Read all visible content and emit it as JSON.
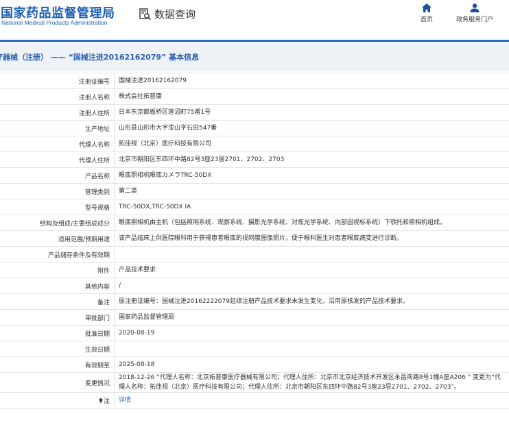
{
  "header": {
    "logo_cn": "国家药品监督管理局",
    "logo_en": "National Medical Products Administration",
    "query_label": "数据查询",
    "nav": [
      {
        "label": "首页",
        "icon": "home-icon"
      },
      {
        "label": "政务服务门户",
        "icon": "user-group-icon"
      }
    ],
    "accent_color": "#2a6cc0"
  },
  "breadcrumb": "疗器械（注册） —— “国械注进20162162079” 基本信息",
  "rows": [
    {
      "key": "注册证编号",
      "value": "国械注进20162162079"
    },
    {
      "key": "注册人名称",
      "value": "株式会社拓普康"
    },
    {
      "key": "注册人住所",
      "value": "日本东京都板桥区莲沼町75番1号"
    },
    {
      "key": "生产地址",
      "value": "山形县山形市大字漆山字石田547番"
    },
    {
      "key": "代理人名称",
      "value": "拓佳视（北京）医疗科技有限公司"
    },
    {
      "key": "代理人住所",
      "value": "北京市朝阳区东四环中路82号3座23层2701、2702、2703"
    },
    {
      "key": "产品名称",
      "value": "眼底照相机眼底カメラTRC-50DX"
    },
    {
      "key": "管理类别",
      "value": "第二类"
    },
    {
      "key": "型号规格",
      "value": "TRC-50DX,TRC-50DX IA"
    },
    {
      "key": "结构及组成/主要组成成分",
      "value": "眼底照相机由主机（包括照明系统、观察系统、摄影光学系统、对焦光学系统、内部固视标系统）下颚托和照相机组成。"
    },
    {
      "key": "适用范围/预期用途",
      "value": "该产品临床上供医院眼科用于获得患者眼底的视网膜图像照片，便于眼科医生对患者眼底病变进行诊断。"
    },
    {
      "key": "产品储存条件及有效期",
      "value": ""
    },
    {
      "key": "附件",
      "value": "产品技术要求"
    },
    {
      "key": "其他内容",
      "value": "/"
    },
    {
      "key": "备注",
      "value": "原注册证编号：国械注进20162222079延续注册产品技术要求未发生变化，沿用原核发的产品技术要求。"
    },
    {
      "key": "审批部门",
      "value": "国家药品监督管理局"
    },
    {
      "key": "批准日期",
      "value": "2020-08-19"
    },
    {
      "key": "生效日期",
      "value": ""
    },
    {
      "key": "有效期至",
      "value": "2025-08-18"
    },
    {
      "key": "变更情况",
      "value": "2018-12-26 “代理人名称：北京拓普康医疗器械有限公司；代理人住所：北京市北京经济技术开发区永昌南路8号1幢A座A206 ” 变更为“代理人名称：拓佳视（北京）医疗科技有限公司；代理人住所：北京市朝阳区东四环中路82号3座23层2701、2702、2703”。"
    },
    {
      "key": "注",
      "value": "详情"
    }
  ]
}
